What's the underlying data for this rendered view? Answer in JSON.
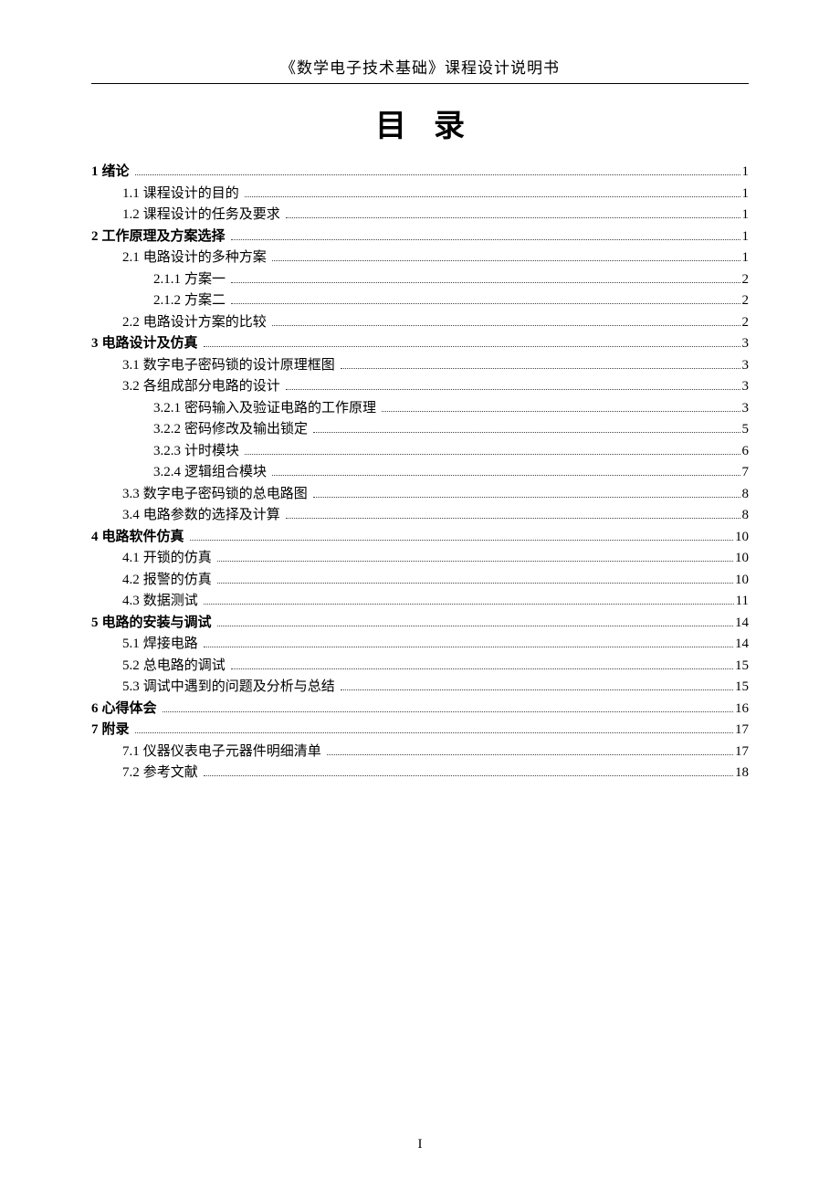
{
  "header": "《数学电子技术基础》课程设计说明书",
  "title": "目录",
  "footer_page": "I",
  "toc": [
    {
      "level": 1,
      "num": "1",
      "text": "绪论",
      "page": "1"
    },
    {
      "level": 2,
      "num": "1.1",
      "text": "课程设计的目的",
      "page": "1"
    },
    {
      "level": 2,
      "num": "1.2",
      "text": "课程设计的任务及要求",
      "page": "1"
    },
    {
      "level": 1,
      "num": "2",
      "text": "工作原理及方案选择",
      "page": "1"
    },
    {
      "level": 2,
      "num": "2.1",
      "text": "电路设计的多种方案",
      "page": "1"
    },
    {
      "level": 3,
      "num": "2.1.1",
      "text": "方案一",
      "page": "2"
    },
    {
      "level": 3,
      "num": "2.1.2",
      "text": "方案二",
      "page": "2"
    },
    {
      "level": 2,
      "num": "2.2",
      "text": "电路设计方案的比较",
      "page": "2"
    },
    {
      "level": 1,
      "num": "3",
      "text": "电路设计及仿真",
      "page": "3"
    },
    {
      "level": 2,
      "num": "3.1",
      "text": "数字电子密码锁的设计原理框图",
      "page": "3"
    },
    {
      "level": 2,
      "num": "3.2",
      "text": "各组成部分电路的设计",
      "page": "3"
    },
    {
      "level": 3,
      "num": "3.2.1",
      "text": "密码输入及验证电路的工作原理",
      "page": "3"
    },
    {
      "level": 3,
      "num": "3.2.2",
      "text": "密码修改及输出锁定",
      "page": "5"
    },
    {
      "level": 3,
      "num": "3.2.3",
      "text": "计时模块",
      "page": "6"
    },
    {
      "level": 3,
      "num": "3.2.4",
      "text": "逻辑组合模块",
      "page": "7"
    },
    {
      "level": 2,
      "num": "3.3",
      "text": "数字电子密码锁的总电路图",
      "page": "8"
    },
    {
      "level": 2,
      "num": "3.4",
      "text": "电路参数的选择及计算",
      "page": "8"
    },
    {
      "level": 1,
      "num": "4",
      "text": "电路软件仿真",
      "page": "10"
    },
    {
      "level": 2,
      "num": "4.1",
      "text": "开锁的仿真",
      "page": "10"
    },
    {
      "level": 2,
      "num": "4.2",
      "text": "报警的仿真",
      "page": "10"
    },
    {
      "level": 2,
      "num": "4.3",
      "text": "数据测试",
      "page": "11"
    },
    {
      "level": 1,
      "num": "5",
      "text": "电路的安装与调试",
      "page": "14"
    },
    {
      "level": 2,
      "num": "5.1",
      "text": "焊接电路",
      "page": "14"
    },
    {
      "level": 2,
      "num": "5.2",
      "text": "总电路的调试",
      "page": "15"
    },
    {
      "level": 2,
      "num": "5.3",
      "text": "调试中遇到的问题及分析与总结",
      "page": "15"
    },
    {
      "level": 1,
      "num": "6",
      "text": "心得体会",
      "page": "16"
    },
    {
      "level": 1,
      "num": "7",
      "text": "附录",
      "page": "17"
    },
    {
      "level": 2,
      "num": "7.1",
      "text": "仪器仪表电子元器件明细清单",
      "page": "17"
    },
    {
      "level": 2,
      "num": "7.2",
      "text": "参考文献",
      "page": "18"
    }
  ]
}
